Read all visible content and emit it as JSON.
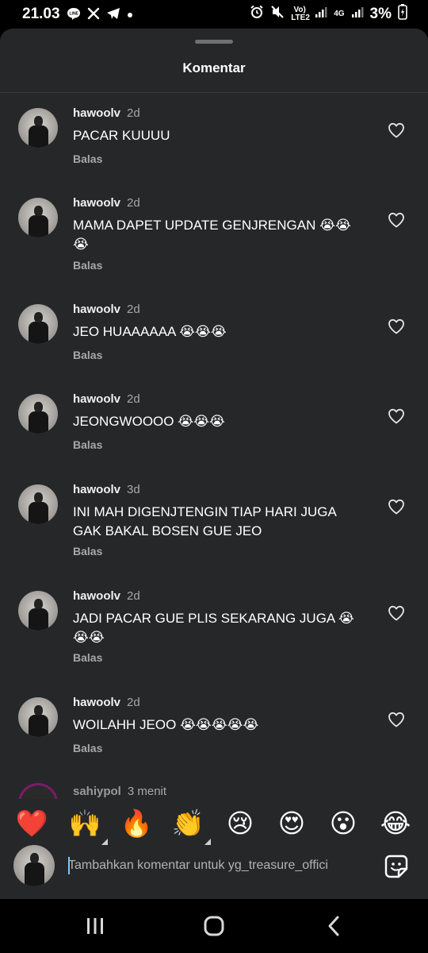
{
  "status_bar": {
    "time": "21.03",
    "notification_icons": [
      "line-icon",
      "x-icon",
      "telegram-icon",
      "dot-icon"
    ],
    "volte_label": "Vo) LTE2",
    "network_label": "4G",
    "battery": "3%"
  },
  "sheet": {
    "title": "Komentar"
  },
  "comments": [
    {
      "user": "hawoolv",
      "time": "2d",
      "text": "PACAR KUUUU",
      "reply": "Balas"
    },
    {
      "user": "hawoolv",
      "time": "2d",
      "text": "MAMA DAPET UPDATE GENJRENGAN 😭😭😭",
      "reply": "Balas"
    },
    {
      "user": "hawoolv",
      "time": "2d",
      "text": "JEO HUAAAAAA 😭😭😭",
      "reply": "Balas"
    },
    {
      "user": "hawoolv",
      "time": "2d",
      "text": "JEONGWOOOO 😭😭😭",
      "reply": "Balas"
    },
    {
      "user": "hawoolv",
      "time": "3d",
      "text": "INI MAH DIGENJTENGIN TIAP HARI JUGA GAK BAKAL BOSEN GUE JEO",
      "reply": "Balas"
    },
    {
      "user": "hawoolv",
      "time": "2d",
      "text": "JADI PACAR GUE PLIS SEKARANG JUGA 😭😭😭",
      "reply": "Balas"
    },
    {
      "user": "hawoolv",
      "time": "2d",
      "text": "WOILAHH JEOO 😭😭😭😭😭",
      "reply": "Balas"
    }
  ],
  "peek_comment": {
    "user": "sahiypol",
    "time": "3 menit"
  },
  "reactions": [
    "❤️",
    "🙌",
    "🔥",
    "👏",
    "😢",
    "😍",
    "😮",
    "😂"
  ],
  "composer": {
    "placeholder": "Tambahkan komentar untuk yg_treasure_offici",
    "value": ""
  }
}
